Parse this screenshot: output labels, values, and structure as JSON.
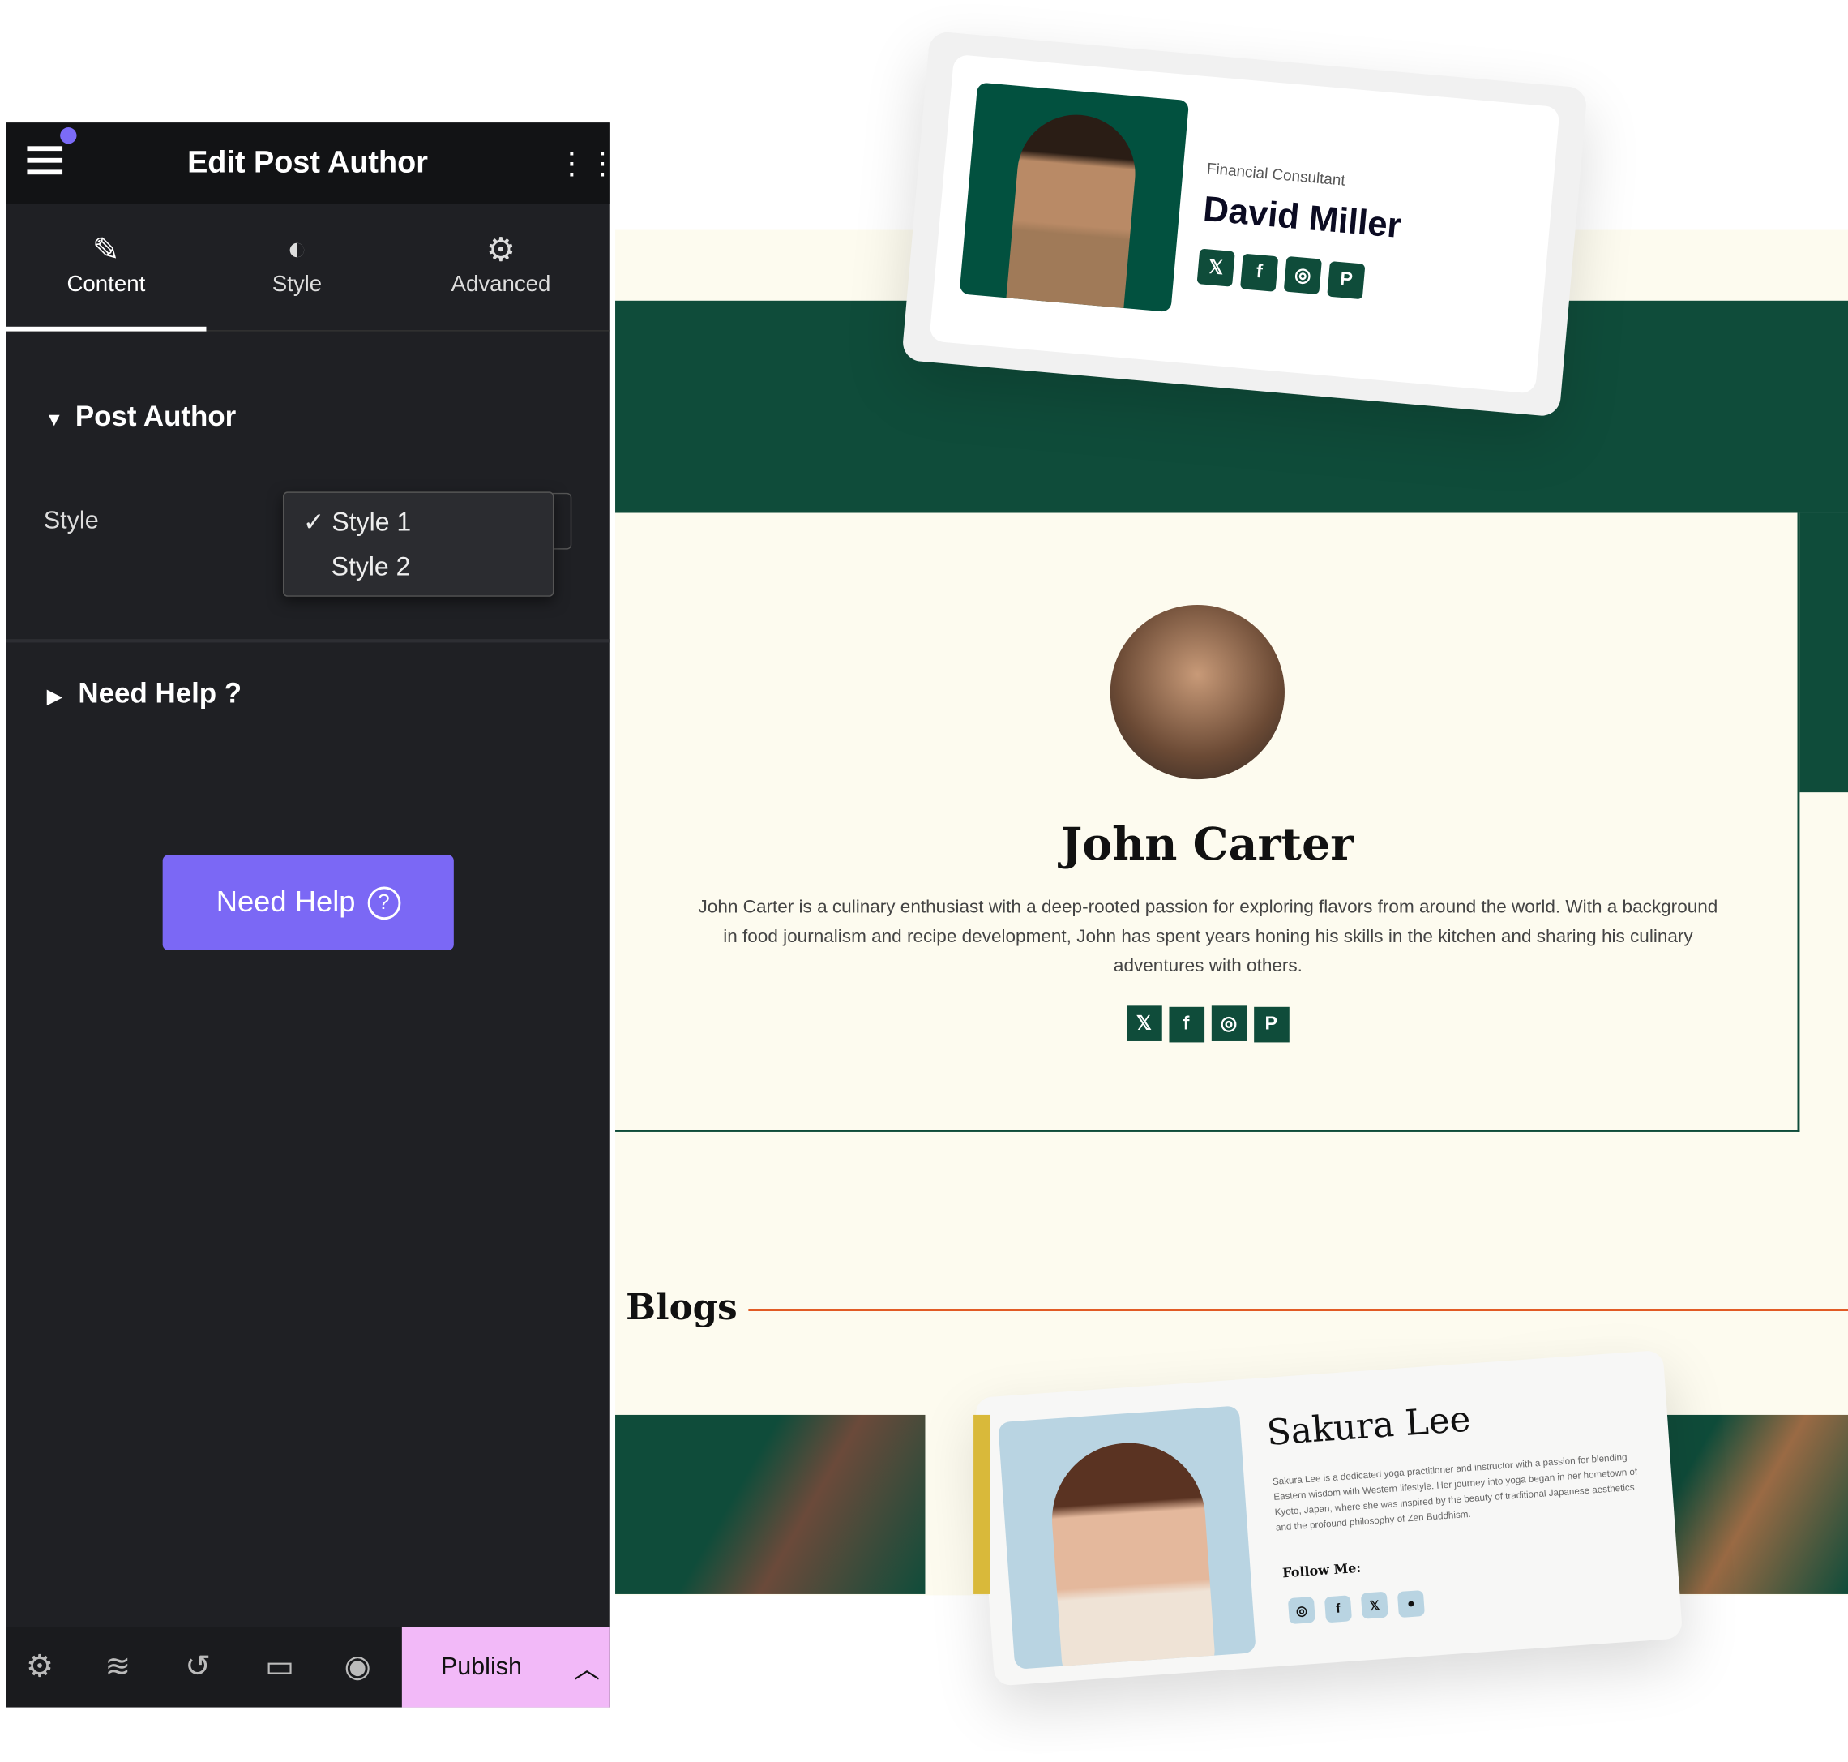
{
  "panel": {
    "title": "Edit Post Author",
    "tabs": [
      {
        "label": "Content",
        "icon": "pencil-icon"
      },
      {
        "label": "Style",
        "icon": "half-circle-icon"
      },
      {
        "label": "Advanced",
        "icon": "gear-icon"
      }
    ],
    "section_title": "Post Author",
    "style_label": "Style",
    "style_options": [
      "Style 1",
      "Style 2"
    ],
    "style_selected": "Style 1",
    "help_section": "Need Help ?",
    "help_button": "Need Help",
    "publish": "Publish"
  },
  "card1": {
    "role": "Financial Consultant",
    "name": "David Miller",
    "socials": [
      "x-icon",
      "facebook-icon",
      "instagram-icon",
      "pinterest-icon"
    ]
  },
  "card2": {
    "name": "John Carter",
    "bio": "John Carter is a culinary enthusiast with a deep-rooted passion for exploring flavors from around the world. With a background in food journalism and recipe development, John has spent years honing his skills in the kitchen and sharing his culinary adventures with others.",
    "socials": [
      "x-icon",
      "facebook-icon",
      "instagram-icon",
      "pinterest-icon"
    ]
  },
  "blogs": {
    "heading": "Blogs"
  },
  "card3": {
    "name": "Sakura Lee",
    "bio": "Sakura Lee is a dedicated yoga practitioner and instructor with a passion for blending Eastern wisdom with Western lifestyle. Her journey into yoga began in her hometown of Kyoto, Japan, where she was inspired by the beauty of traditional Japanese aesthetics and the profound philosophy of Zen Buddhism.",
    "follow": "Follow Me:",
    "socials": [
      "instagram-icon",
      "facebook-icon",
      "x-icon",
      "reddit-icon"
    ]
  },
  "colors": {
    "brand_green": "#0f4c3a",
    "accent_purple": "#7b68f5",
    "publish_pink": "#f2b9f8",
    "cream": "#fdfbef",
    "blogs_line": "#e0541c"
  }
}
